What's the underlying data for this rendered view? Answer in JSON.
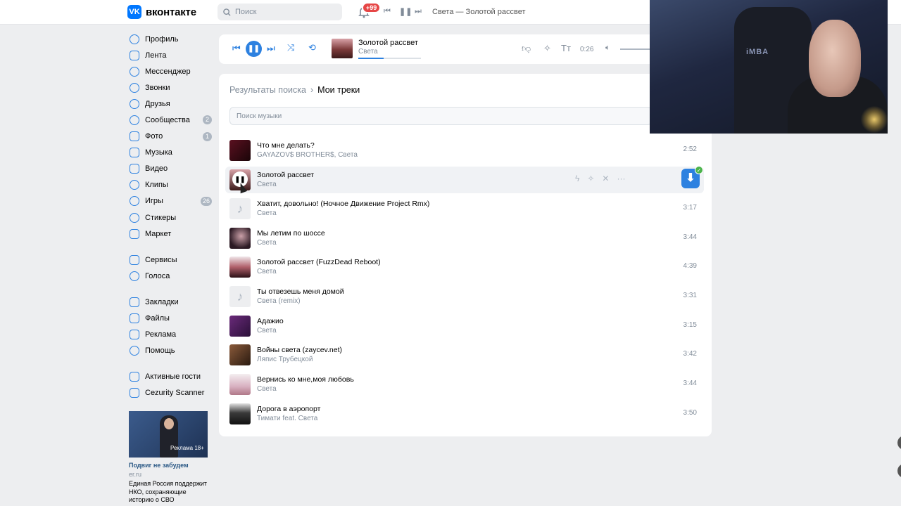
{
  "header": {
    "logo_text": "вконтакте",
    "logo_letter": "VK",
    "search_placeholder": "Поиск",
    "notifications_badge": "+99",
    "now_playing": "Света — Золотой рассвет"
  },
  "sidebar": {
    "items": [
      {
        "label": "Профиль",
        "badge": ""
      },
      {
        "label": "Лента",
        "badge": ""
      },
      {
        "label": "Мессенджер",
        "badge": ""
      },
      {
        "label": "Звонки",
        "badge": ""
      },
      {
        "label": "Друзья",
        "badge": ""
      },
      {
        "label": "Сообщества",
        "badge": "2"
      },
      {
        "label": "Фото",
        "badge": "1"
      },
      {
        "label": "Музыка",
        "badge": ""
      },
      {
        "label": "Видео",
        "badge": ""
      },
      {
        "label": "Клипы",
        "badge": ""
      },
      {
        "label": "Игры",
        "badge": "26"
      },
      {
        "label": "Стикеры",
        "badge": ""
      },
      {
        "label": "Маркет",
        "badge": ""
      }
    ],
    "items2": [
      {
        "label": "Сервисы"
      },
      {
        "label": "Голоса"
      }
    ],
    "items3": [
      {
        "label": "Закладки"
      },
      {
        "label": "Файлы"
      },
      {
        "label": "Реклама"
      },
      {
        "label": "Помощь"
      }
    ],
    "items4": [
      {
        "label": "Активные гости"
      },
      {
        "label": "Cezurity Scanner"
      }
    ],
    "ad": {
      "image_tag": "Реклама 18+",
      "title": "Подвиг не забудем",
      "domain": "er.ru",
      "text": "Единая Россия поддержит НКО, сохраняющие историю о СВО"
    }
  },
  "player": {
    "title": "Золотой рассвет",
    "artist": "Света",
    "time": "0:26",
    "progress": 0.4,
    "text_icon": "Тт"
  },
  "main": {
    "breadcrumb_parent": "Результаты поиска",
    "breadcrumb_current": "Мои треки",
    "search_placeholder": "Поиск музыки",
    "tracks": [
      {
        "title": "Что мне делать?",
        "artist": "GAYAZOV$ BROTHER$, Света",
        "duration": "2:52"
      },
      {
        "title": "Золотой рассвет",
        "artist": "Света",
        "duration": ""
      },
      {
        "title": "Хватит, довольно! (Ночное Движение Project Rmx)",
        "artist": "Света",
        "duration": "3:17"
      },
      {
        "title": "Мы летим по шоссе",
        "artist": "Света",
        "duration": "3:44"
      },
      {
        "title": "Золотой рассвет (FuzzDead Reboot)",
        "artist": "Света",
        "duration": "4:39"
      },
      {
        "title": "Ты отвезешь меня домой",
        "artist": "Света (remix)",
        "duration": "3:31"
      },
      {
        "title": "Адажио",
        "artist": "Света",
        "duration": "3:15"
      },
      {
        "title": "Войны света (zaycev.net)",
        "artist": "Ляпис Трубецкой",
        "duration": "3:42"
      },
      {
        "title": "Вернись ко мне,моя любовь",
        "artist": "Света",
        "duration": "3:44"
      },
      {
        "title": "Дорога в аэропорт",
        "artist": "Тимати feat. Света",
        "duration": "3:50"
      }
    ]
  },
  "webcam": {
    "chair_text": "iMBA"
  }
}
